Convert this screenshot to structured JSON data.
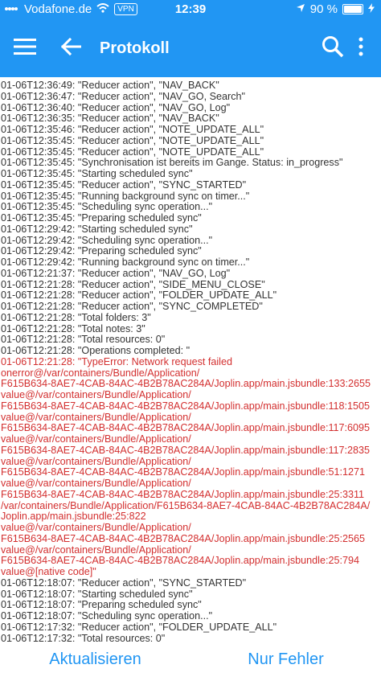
{
  "status_bar": {
    "carrier": "Vodafone.de",
    "vpn": "VPN",
    "time": "12:39",
    "battery": "90 %",
    "battery_level": 0.9
  },
  "header": {
    "title": "Protokoll",
    "menu_icon": "hamburger-menu-icon",
    "back_icon": "arrow-back-icon",
    "search_icon": "search-icon",
    "more_icon": "more-vertical-icon",
    "color": "#2196f3"
  },
  "log_lines": [
    {
      "text": "01-06T12:36:49: \"Reducer action\", \"NAV_BACK\"",
      "error": false
    },
    {
      "text": "01-06T12:36:47: \"Reducer action\", \"NAV_GO, Search\"",
      "error": false
    },
    {
      "text": "01-06T12:36:40: \"Reducer action\", \"NAV_GO, Log\"",
      "error": false
    },
    {
      "text": "01-06T12:36:35: \"Reducer action\", \"NAV_BACK\"",
      "error": false
    },
    {
      "text": "01-06T12:35:46: \"Reducer action\", \"NOTE_UPDATE_ALL\"",
      "error": false
    },
    {
      "text": "01-06T12:35:45: \"Reducer action\", \"NOTE_UPDATE_ALL\"",
      "error": false
    },
    {
      "text": "01-06T12:35:45: \"Reducer action\", \"NOTE_UPDATE_ALL\"",
      "error": false
    },
    {
      "text": "01-06T12:35:45: \"Synchronisation ist bereits im Gange. Status: in_progress\"",
      "error": false
    },
    {
      "text": "01-06T12:35:45: \"Starting scheduled sync\"",
      "error": false
    },
    {
      "text": "01-06T12:35:45: \"Reducer action\", \"SYNC_STARTED\"",
      "error": false
    },
    {
      "text": "01-06T12:35:45: \"Running background sync on timer...\"",
      "error": false
    },
    {
      "text": "01-06T12:35:45: \"Scheduling sync operation...\"",
      "error": false
    },
    {
      "text": "01-06T12:35:45: \"Preparing scheduled sync\"",
      "error": false
    },
    {
      "text": "01-06T12:29:42: \"Starting scheduled sync\"",
      "error": false
    },
    {
      "text": "01-06T12:29:42: \"Scheduling sync operation...\"",
      "error": false
    },
    {
      "text": "01-06T12:29:42: \"Preparing scheduled sync\"",
      "error": false
    },
    {
      "text": "01-06T12:29:42: \"Running background sync on timer...\"",
      "error": false
    },
    {
      "text": "01-06T12:21:37: \"Reducer action\", \"NAV_GO, Log\"",
      "error": false
    },
    {
      "text": "01-06T12:21:28: \"Reducer action\", \"SIDE_MENU_CLOSE\"",
      "error": false
    },
    {
      "text": "01-06T12:21:28: \"Reducer action\", \"FOLDER_UPDATE_ALL\"",
      "error": false
    },
    {
      "text": "01-06T12:21:28: \"Reducer action\", \"SYNC_COMPLETED\"",
      "error": false
    },
    {
      "text": "01-06T12:21:28: \"Total folders: 3\"",
      "error": false
    },
    {
      "text": "01-06T12:21:28: \"Total notes: 3\"",
      "error": false
    },
    {
      "text": "01-06T12:21:28: \"Total resources: 0\"",
      "error": false
    },
    {
      "text": "01-06T12:21:28: \"Operations completed: \"",
      "error": false
    },
    {
      "text": "01-06T12:21:28: \"TypeError: Network request failed",
      "error": true
    },
    {
      "text": "onerror@/var/containers/Bundle/Application/",
      "error": true
    },
    {
      "text": "F615B634-8AE7-4CAB-84AC-4B2B78AC284A/Joplin.app/main.jsbundle:133:2655",
      "error": true
    },
    {
      "text": "value@/var/containers/Bundle/Application/",
      "error": true
    },
    {
      "text": "F615B634-8AE7-4CAB-84AC-4B2B78AC284A/Joplin.app/main.jsbundle:118:1505",
      "error": true
    },
    {
      "text": "value@/var/containers/Bundle/Application/",
      "error": true
    },
    {
      "text": "F615B634-8AE7-4CAB-84AC-4B2B78AC284A/Joplin.app/main.jsbundle:117:6095",
      "error": true
    },
    {
      "text": "value@/var/containers/Bundle/Application/",
      "error": true
    },
    {
      "text": "F615B634-8AE7-4CAB-84AC-4B2B78AC284A/Joplin.app/main.jsbundle:117:2835",
      "error": true
    },
    {
      "text": "value@/var/containers/Bundle/Application/",
      "error": true
    },
    {
      "text": "F615B634-8AE7-4CAB-84AC-4B2B78AC284A/Joplin.app/main.jsbundle:51:1271",
      "error": true
    },
    {
      "text": "value@/var/containers/Bundle/Application/",
      "error": true
    },
    {
      "text": "F615B634-8AE7-4CAB-84AC-4B2B78AC284A/Joplin.app/main.jsbundle:25:3311",
      "error": true
    },
    {
      "text": "/var/containers/Bundle/Application/F615B634-8AE7-4CAB-84AC-4B2B78AC284A/",
      "error": true
    },
    {
      "text": "Joplin.app/main.jsbundle:25:822",
      "error": true
    },
    {
      "text": "value@/var/containers/Bundle/Application/",
      "error": true
    },
    {
      "text": "F615B634-8AE7-4CAB-84AC-4B2B78AC284A/Joplin.app/main.jsbundle:25:2565",
      "error": true
    },
    {
      "text": "value@/var/containers/Bundle/Application/",
      "error": true
    },
    {
      "text": "F615B634-8AE7-4CAB-84AC-4B2B78AC284A/Joplin.app/main.jsbundle:25:794",
      "error": true
    },
    {
      "text": "value@[native code]\"",
      "error": true
    },
    {
      "text": "01-06T12:18:07: \"Reducer action\", \"SYNC_STARTED\"",
      "error": false
    },
    {
      "text": "01-06T12:18:07: \"Starting scheduled sync\"",
      "error": false
    },
    {
      "text": "01-06T12:18:07: \"Preparing scheduled sync\"",
      "error": false
    },
    {
      "text": "01-06T12:18:07: \"Scheduling sync operation...\"",
      "error": false
    },
    {
      "text": "01-06T12:17:32: \"Reducer action\", \"FOLDER_UPDATE_ALL\"",
      "error": false
    },
    {
      "text": "01-06T12:17:32: \"Total resources: 0\"",
      "error": false
    }
  ],
  "bottom_bar": {
    "refresh_label": "Aktualisieren",
    "errors_only_label": "Nur Fehler"
  },
  "colors": {
    "accent": "#2196f3",
    "error_text": "#d32f2f",
    "log_text": "#333333"
  }
}
